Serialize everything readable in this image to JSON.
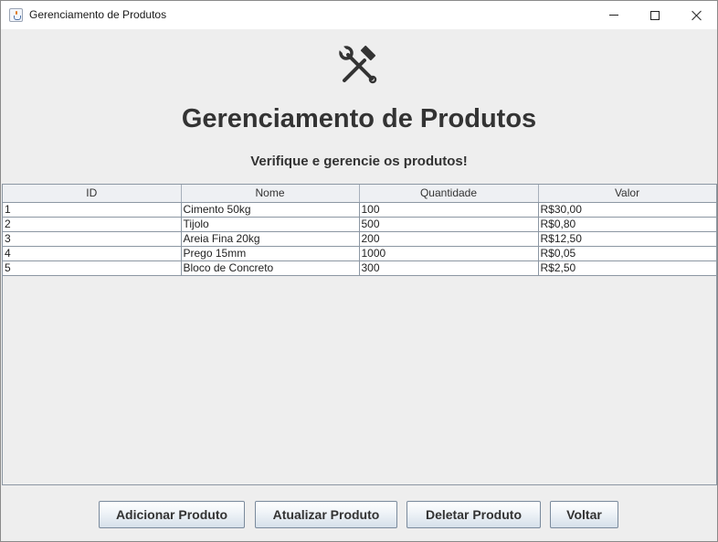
{
  "window": {
    "title": "Gerenciamento de Produtos"
  },
  "header": {
    "icon": "tools-hammer-wrench-icon",
    "title": "Gerenciamento de Produtos",
    "subtitle": "Verifique e gerencie os produtos!"
  },
  "table": {
    "columns": [
      "ID",
      "Nome",
      "Quantidade",
      "Valor"
    ],
    "rows": [
      [
        "1",
        "Cimento 50kg",
        "100",
        "R$30,00"
      ],
      [
        "2",
        "Tijolo",
        "500",
        "R$0,80"
      ],
      [
        "3",
        "Areia Fina 20kg",
        "200",
        "R$12,50"
      ],
      [
        "4",
        "Prego 15mm",
        "1000",
        "R$0,05"
      ],
      [
        "5",
        "Bloco de Concreto",
        "300",
        "R$2,50"
      ]
    ]
  },
  "buttons": {
    "add": "Adicionar Produto",
    "update": "Atualizar Produto",
    "delete": "Deletar Produto",
    "back": "Voltar"
  },
  "colors": {
    "background": "#eeeeee",
    "text": "#333333",
    "table_border": "#8c97a3"
  }
}
